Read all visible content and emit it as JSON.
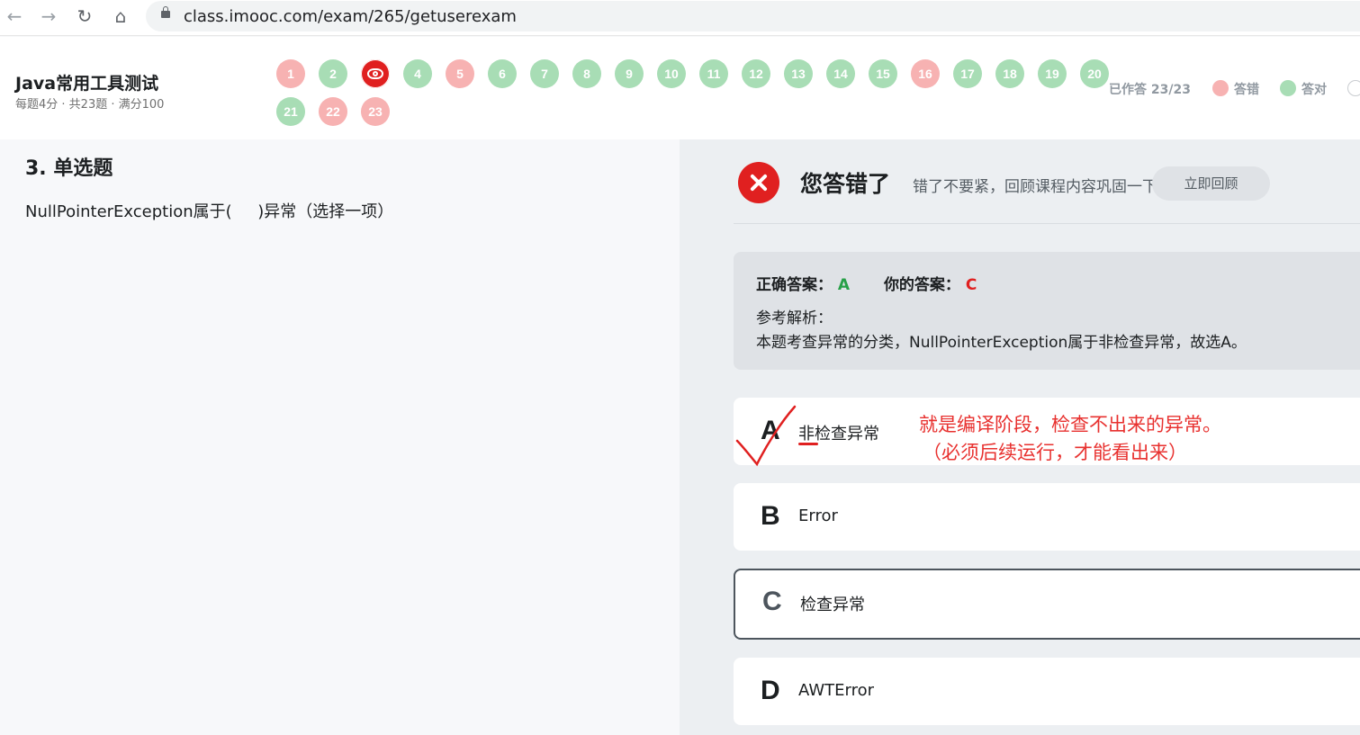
{
  "browser": {
    "url": "class.imooc.com/exam/265/getuserexam",
    "back": "←",
    "forward": "→",
    "reload": "↻",
    "home": "⌂"
  },
  "exam": {
    "title": "Java常用工具测试",
    "meta": "每题4分 · 共23题 · 满分100",
    "questions": [
      {
        "n": "1",
        "state": "wrong"
      },
      {
        "n": "2",
        "state": "right"
      },
      {
        "n": "3",
        "state": "current"
      },
      {
        "n": "4",
        "state": "right"
      },
      {
        "n": "5",
        "state": "wrong"
      },
      {
        "n": "6",
        "state": "right"
      },
      {
        "n": "7",
        "state": "right"
      },
      {
        "n": "8",
        "state": "right"
      },
      {
        "n": "9",
        "state": "right"
      },
      {
        "n": "10",
        "state": "right"
      },
      {
        "n": "11",
        "state": "right"
      },
      {
        "n": "12",
        "state": "right"
      },
      {
        "n": "13",
        "state": "right"
      },
      {
        "n": "14",
        "state": "right"
      },
      {
        "n": "15",
        "state": "right"
      },
      {
        "n": "16",
        "state": "wrong"
      },
      {
        "n": "17",
        "state": "right"
      },
      {
        "n": "18",
        "state": "right"
      },
      {
        "n": "19",
        "state": "right"
      },
      {
        "n": "20",
        "state": "right"
      },
      {
        "n": "21",
        "state": "right"
      },
      {
        "n": "22",
        "state": "wrong"
      },
      {
        "n": "23",
        "state": "wrong"
      }
    ],
    "answered": "已作答 23/23",
    "legend_wrong": "答错",
    "legend_right": "答对",
    "colors": {
      "right": "#a8ddb5",
      "wrong": "#f7b2b2",
      "current": "#e02020"
    }
  },
  "question": {
    "type": "3. 单选题",
    "text": "NullPointerException属于(     )异常（选择一项）"
  },
  "result": {
    "title": "您答错了",
    "subtitle": "错了不要紧，回顾课程内容巩固一下",
    "review_button": "立即回顾",
    "correct_label": "正确答案：",
    "correct_value": "A",
    "yours_label": "你的答案：",
    "yours_value": "C",
    "ref_label": "参考解析：",
    "ref_text": "本题考查异常的分类，NullPointerException属于非检查异常，故选A。"
  },
  "options": [
    {
      "letter": "A",
      "text": "非检查异常"
    },
    {
      "letter": "B",
      "text": "Error"
    },
    {
      "letter": "C",
      "text": "检查异常"
    },
    {
      "letter": "D",
      "text": "AWTError"
    }
  ],
  "annotation": {
    "line1": "就是编译阶段，检查不出来的异常。",
    "line2": "（必须后续运行，才能看出来）"
  }
}
